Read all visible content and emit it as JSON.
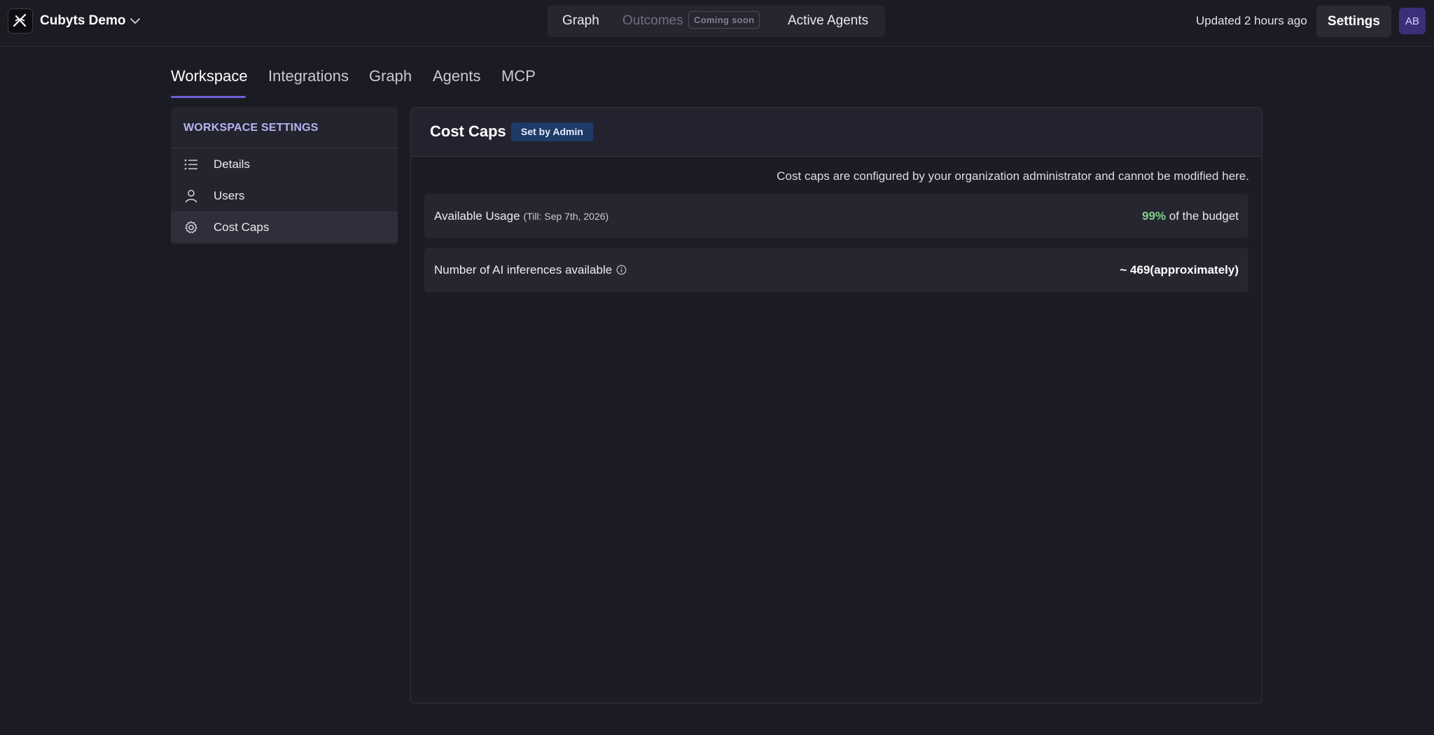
{
  "header": {
    "workspace_name": "Cubyts Demo",
    "nav": {
      "graph": "Graph",
      "outcomes": "Outcomes",
      "outcomes_badge": "Coming soon",
      "active_agents": "Active Agents"
    },
    "updated_text": "Updated 2 hours ago",
    "settings_label": "Settings",
    "avatar_initials": "AB"
  },
  "tabs": [
    {
      "label": "Workspace",
      "active": true
    },
    {
      "label": "Integrations"
    },
    {
      "label": "Graph"
    },
    {
      "label": "Agents"
    },
    {
      "label": "MCP"
    }
  ],
  "sidebar": {
    "heading": "WORKSPACE SETTINGS",
    "items": [
      {
        "label": "Details",
        "icon": "list-icon"
      },
      {
        "label": "Users",
        "icon": "user-icon"
      },
      {
        "label": "Cost Caps",
        "icon": "gear-icon",
        "active": true
      }
    ]
  },
  "main": {
    "title": "Cost Caps",
    "badge": "Set by Admin",
    "note": "Cost caps are configured by your organization administrator and cannot be modified here.",
    "usage": {
      "label": "Available Usage",
      "till": "(Till: Sep 7th, 2026)",
      "percent": "99%",
      "suffix": " of the budget"
    },
    "inferences": {
      "label": "Number of AI inferences available",
      "value": "~ 469(approximately)"
    }
  },
  "colors": {
    "accent": "#6b5fd6",
    "success": "#7fd08a",
    "badge_bg": "#1e3a66"
  }
}
